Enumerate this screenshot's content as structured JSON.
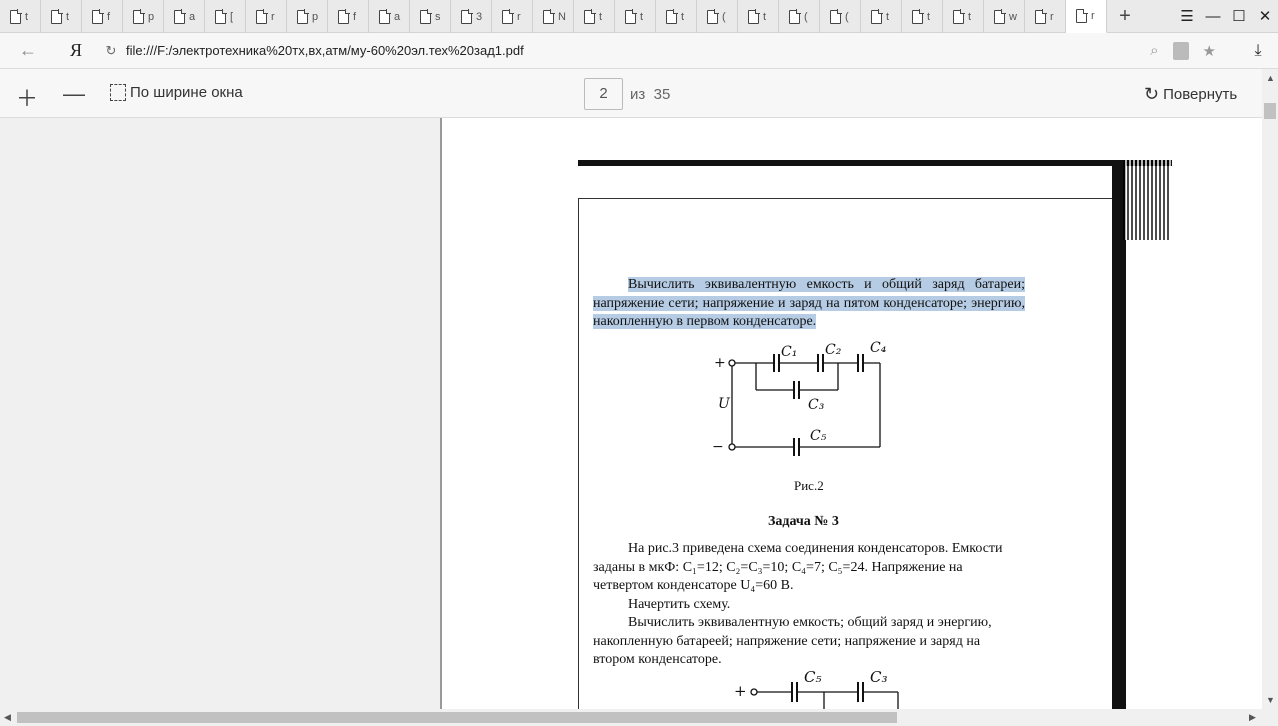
{
  "tabs": [
    {
      "letter": "t"
    },
    {
      "letter": "t"
    },
    {
      "letter": "f"
    },
    {
      "letter": "p"
    },
    {
      "letter": "a"
    },
    {
      "letter": "["
    },
    {
      "letter": "r"
    },
    {
      "letter": "p"
    },
    {
      "letter": "f"
    },
    {
      "letter": "a"
    },
    {
      "letter": "s"
    },
    {
      "letter": "3"
    },
    {
      "letter": "r"
    },
    {
      "letter": "N"
    },
    {
      "letter": "t"
    },
    {
      "letter": "t"
    },
    {
      "letter": "t"
    },
    {
      "letter": "("
    },
    {
      "letter": "t"
    },
    {
      "letter": "("
    },
    {
      "letter": "("
    },
    {
      "letter": "t"
    },
    {
      "letter": "t"
    },
    {
      "letter": "t"
    },
    {
      "letter": "w"
    },
    {
      "letter": "r"
    },
    {
      "letter": "r"
    }
  ],
  "address": {
    "logo": "Я",
    "url": "file:///F:/электротехника%20тх,вх,атм/му-60%20эл.тех%20зад1.pdf"
  },
  "toolbar": {
    "fit_label": "По ширине окна",
    "page_current": "2",
    "page_of_label": "из",
    "page_total": "35",
    "rotate_label": "Повернуть"
  },
  "document": {
    "para1": "Вычислить эквивалентную емкость и общий заряд батареи; напряжение сети; напряжение и заряд на пятом конденсаторе; энергию, накопленную в первом конденсаторе.",
    "fig_caption": "Рис.2",
    "task_title": "Задача № 3",
    "para2_line1": "На рис.3 приведена схема соединения конденсаторов. Емкости",
    "para2_line2": "заданы в мкФ: C₁=12; C₂=C₃=10; C₄=7; C₅=24. Напряжение на",
    "para2_line3": "четвертом конденсаторе U₄=60 В.",
    "para3": "Начертить схему.",
    "para4_line1": "Вычислить эквивалентную емкость; общий заряд и энергию,",
    "para4_line2": "накопленную батареей; напряжение сети; напряжение и заряд на",
    "para4_line3": "втором конденсаторе.",
    "circuit_labels": {
      "plus": "+",
      "minus": "−",
      "u": "U",
      "c1": "C₁",
      "c2": "C₂",
      "c3": "C₃",
      "c4": "C₄",
      "c5": "C₅"
    },
    "circuit2_labels": {
      "plus": "+",
      "c5": "C₅",
      "c3": "C₃"
    }
  }
}
